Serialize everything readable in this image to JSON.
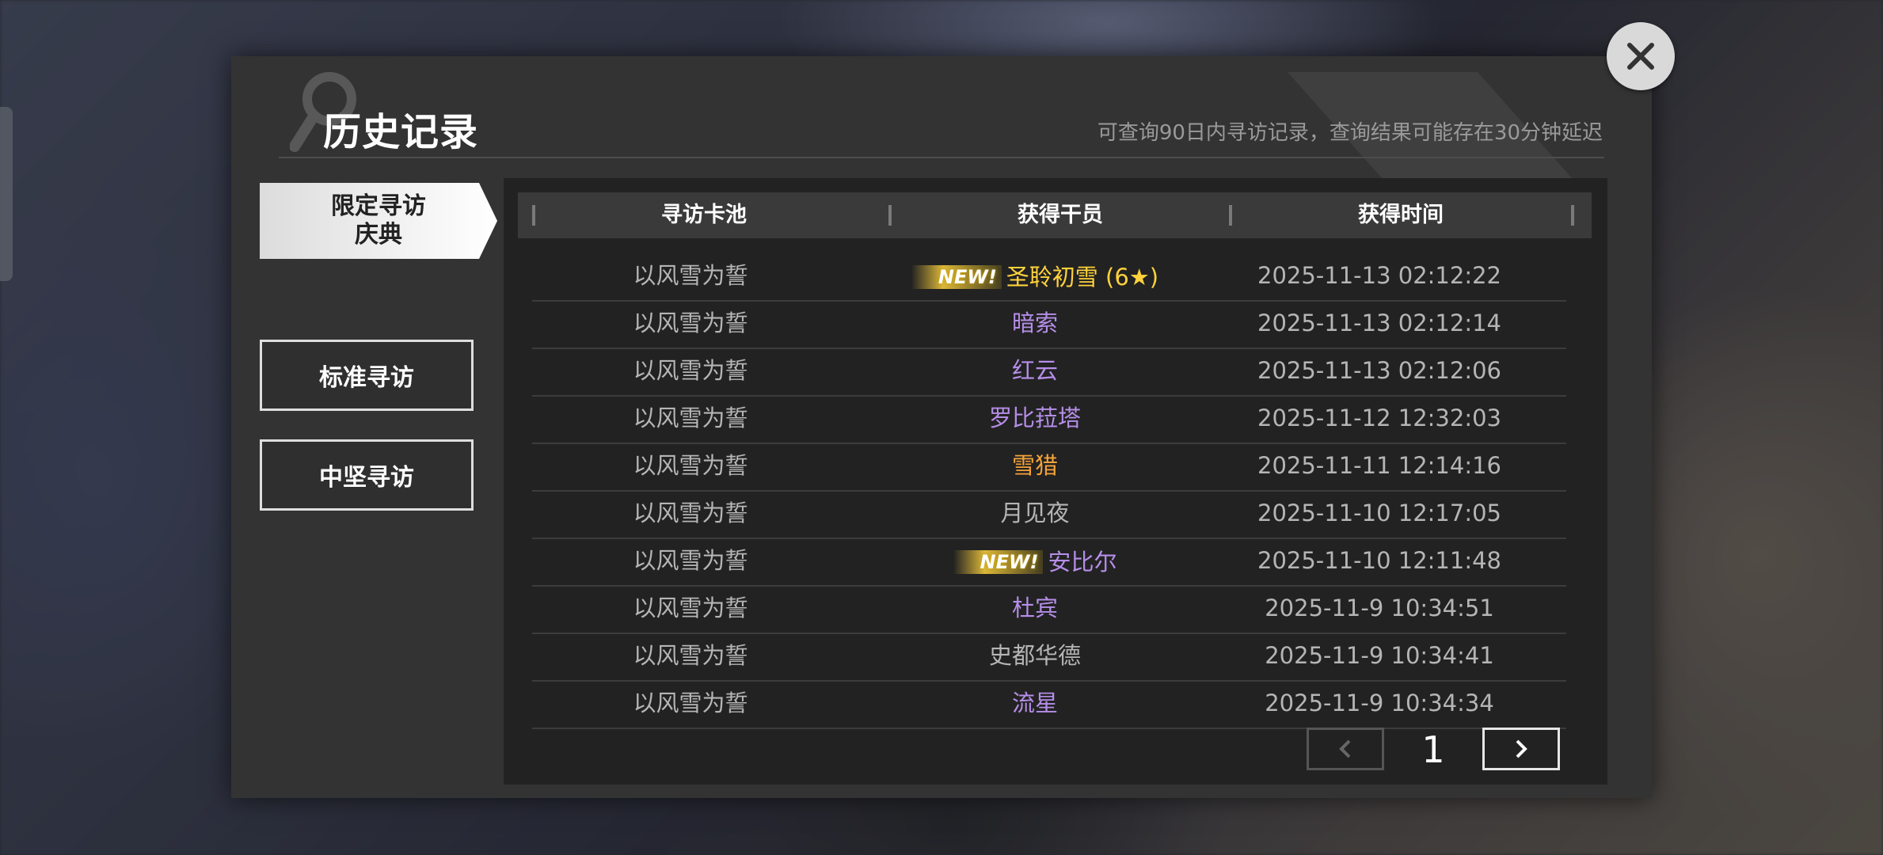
{
  "colors": {
    "default_text": "#b5b5b5",
    "purple_operator": "#b58ee8",
    "orange_operator": "#f5a33a",
    "gold_operator": "#ffd23c",
    "dialog_bg": "#333333"
  },
  "icons": {
    "close": "close-icon",
    "prev": "chevron-left-icon",
    "next": "chevron-right-icon",
    "search_deco": "magnifier-icon"
  },
  "header": {
    "title": "历史记录",
    "subtitle": "可查询90日内寻访记录，查询结果可能存在30分钟延迟"
  },
  "tabs": [
    {
      "label": "限定寻访\n庆典",
      "active": true
    },
    {
      "label": "标准寻访",
      "active": false
    },
    {
      "label": "中坚寻访",
      "active": false
    }
  ],
  "table": {
    "headers": [
      "寻访卡池",
      "获得干员",
      "获得时间"
    ],
    "rows": [
      {
        "pool": "以风雪为誓",
        "operator": "圣聆初雪 (6★)",
        "time": "2025-11-13 02:12:22",
        "new": true,
        "new_label": "NEW!",
        "color": "#ffd23c"
      },
      {
        "pool": "以风雪为誓",
        "operator": "暗索",
        "time": "2025-11-13 02:12:14",
        "new": false,
        "new_label": "",
        "color": "#b58ee8"
      },
      {
        "pool": "以风雪为誓",
        "operator": "红云",
        "time": "2025-11-13 02:12:06",
        "new": false,
        "new_label": "",
        "color": "#b58ee8"
      },
      {
        "pool": "以风雪为誓",
        "operator": "罗比菈塔",
        "time": "2025-11-12 12:32:03",
        "new": false,
        "new_label": "",
        "color": "#b58ee8"
      },
      {
        "pool": "以风雪为誓",
        "operator": "雪猎",
        "time": "2025-11-11 12:14:16",
        "new": false,
        "new_label": "",
        "color": "#f5a33a"
      },
      {
        "pool": "以风雪为誓",
        "operator": "月见夜",
        "time": "2025-11-10 12:17:05",
        "new": false,
        "new_label": "",
        "color": "#b5b5b5"
      },
      {
        "pool": "以风雪为誓",
        "operator": "安比尔",
        "time": "2025-11-10 12:11:48",
        "new": true,
        "new_label": "NEW!",
        "color": "#b58ee8"
      },
      {
        "pool": "以风雪为誓",
        "operator": "杜宾",
        "time": "2025-11-9 10:34:51",
        "new": false,
        "new_label": "",
        "color": "#b58ee8"
      },
      {
        "pool": "以风雪为誓",
        "operator": "史都华德",
        "time": "2025-11-9 10:34:41",
        "new": false,
        "new_label": "",
        "color": "#b5b5b5"
      },
      {
        "pool": "以风雪为誓",
        "operator": "流星",
        "time": "2025-11-9 10:34:34",
        "new": false,
        "new_label": "",
        "color": "#b58ee8"
      }
    ]
  },
  "pager": {
    "page": "1"
  }
}
